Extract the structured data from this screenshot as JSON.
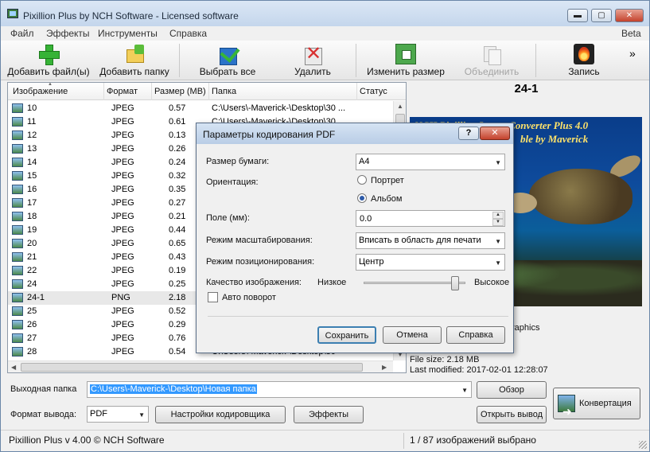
{
  "window": {
    "title": "Pixillion Plus by NCH Software - Licensed software",
    "min_label": "▬",
    "max_label": "▢",
    "close_label": "✕"
  },
  "menu": {
    "items": [
      "Файл",
      "Эффекты",
      "Инструменты",
      "Справка"
    ],
    "beta": "Beta"
  },
  "toolbar": {
    "add_files": "Добавить файл(ы)",
    "add_folder": "Добавить папку",
    "select_all": "Выбрать все",
    "delete": "Удалить",
    "resize": "Изменить размер",
    "merge": "Объединить",
    "burn": "Запись",
    "more": "»"
  },
  "list": {
    "columns": [
      "Изображение",
      "Формат",
      "Размер (MB)",
      "Папка",
      "Статус"
    ],
    "rows": [
      {
        "name": "10",
        "format": "JPEG",
        "size": "0.57",
        "folder": "C:\\Users\\-Maverick-\\Desktop\\30 ..."
      },
      {
        "name": "11",
        "format": "JPEG",
        "size": "0.61",
        "folder": "C:\\Users\\-Maverick-\\Desktop\\30"
      },
      {
        "name": "12",
        "format": "JPEG",
        "size": "0.13",
        "folder": ""
      },
      {
        "name": "13",
        "format": "JPEG",
        "size": "0.26",
        "folder": ""
      },
      {
        "name": "14",
        "format": "JPEG",
        "size": "0.24",
        "folder": ""
      },
      {
        "name": "15",
        "format": "JPEG",
        "size": "0.32",
        "folder": ""
      },
      {
        "name": "16",
        "format": "JPEG",
        "size": "0.35",
        "folder": ""
      },
      {
        "name": "17",
        "format": "JPEG",
        "size": "0.27",
        "folder": ""
      },
      {
        "name": "18",
        "format": "JPEG",
        "size": "0.21",
        "folder": ""
      },
      {
        "name": "19",
        "format": "JPEG",
        "size": "0.44",
        "folder": ""
      },
      {
        "name": "20",
        "format": "JPEG",
        "size": "0.65",
        "folder": ""
      },
      {
        "name": "21",
        "format": "JPEG",
        "size": "0.43",
        "folder": ""
      },
      {
        "name": "22",
        "format": "JPEG",
        "size": "0.19",
        "folder": ""
      },
      {
        "name": "24",
        "format": "JPEG",
        "size": "0.25",
        "folder": ""
      },
      {
        "name": "24-1",
        "format": "PNG",
        "size": "2.18",
        "folder": ""
      },
      {
        "name": "25",
        "format": "JPEG",
        "size": "0.52",
        "folder": ""
      },
      {
        "name": "26",
        "format": "JPEG",
        "size": "0.29",
        "folder": ""
      },
      {
        "name": "27",
        "format": "JPEG",
        "size": "0.76",
        "folder": ""
      },
      {
        "name": "28",
        "format": "JPEG",
        "size": "0.54",
        "folder": "C:\\Users\\-Maverick-\\Desktop\\30"
      }
    ],
    "selected_index": 14
  },
  "preview": {
    "title": "24-1",
    "caption_line1": "NCH Pixillion Image Converter Plus 4.0",
    "caption_line2": "ble by Maverick",
    "partial_text": "raphics",
    "file_size": "File size: 2.18 MB",
    "last_modified": "Last modified: 2017-02-01 12:28:07"
  },
  "output": {
    "folder_label": "Выходная папка",
    "folder_value": "C:\\Users\\-Maverick-\\Desktop\\Новая папка",
    "browse": "Обзор",
    "format_label": "Формат вывода:",
    "format_value": "PDF",
    "encoder_settings": "Настройки кодировщика",
    "effects": "Эффекты",
    "open_output": "Открыть вывод",
    "convert": "Конвертация"
  },
  "status": {
    "left": "Pixillion Plus v 4.00 © NCH Software",
    "right": "1 / 87 изображений выбрано"
  },
  "dialog": {
    "title": "Параметры кодирования PDF",
    "help": "?",
    "close": "✕",
    "paper_size_label": "Размер бумаги:",
    "paper_size_value": "A4",
    "orientation_label": "Ориентация:",
    "portrait": "Портрет",
    "landscape": "Альбом",
    "orientation_selected": "landscape",
    "margin_label": "Поле (мм):",
    "margin_value": "0.0",
    "scale_label": "Режим масштабирования:",
    "scale_value": "Вписать в область для печати",
    "position_label": "Режим позиционирования:",
    "position_value": "Центр",
    "quality_label": "Качество изображения:",
    "quality_low": "Низкое",
    "quality_high": "Высокое",
    "quality_level": 0.9,
    "auto_rotate": "Авто поворот",
    "auto_rotate_checked": false,
    "save": "Сохранить",
    "cancel": "Отмена",
    "help_button": "Справка"
  }
}
